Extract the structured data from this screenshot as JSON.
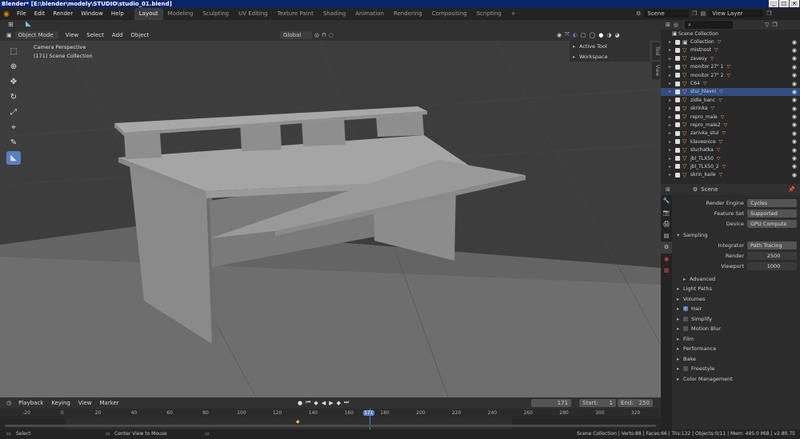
{
  "window": {
    "title": "Blender* [E:\\blender\\modely\\STUDIO\\studio_01.blend]"
  },
  "topbar": {
    "menus": [
      "File",
      "Edit",
      "Render",
      "Window",
      "Help"
    ],
    "workspaces": [
      "Layout",
      "Modeling",
      "Sculpting",
      "UV Editing",
      "Texture Paint",
      "Shading",
      "Animation",
      "Rendering",
      "Compositing",
      "Scripting"
    ],
    "active_workspace": "Layout",
    "add_tab": "+",
    "scene": "Scene",
    "view_layer": "View Layer"
  },
  "viewport_header": {
    "mode": "Object Mode",
    "menus": [
      "View",
      "Select",
      "Add",
      "Object"
    ],
    "orientation": "Global"
  },
  "viewport": {
    "camera_label": "Camera Perspective",
    "collection_label": "(171) Scene Collection",
    "n_panel": {
      "items": [
        "Active Tool",
        "Workspace"
      ],
      "tabs": [
        "Tool",
        "View"
      ]
    }
  },
  "timeline": {
    "menus": [
      "Playback",
      "Keying",
      "View",
      "Marker"
    ],
    "current_frame": "171",
    "start_label": "Start:",
    "start": "1",
    "end_label": "End:",
    "end": "250",
    "ruler": [
      "-20",
      "0",
      "20",
      "40",
      "60",
      "80",
      "100",
      "120",
      "140",
      "160",
      "171",
      "180",
      "200",
      "220",
      "240",
      "260",
      "280",
      "300",
      "320"
    ]
  },
  "outliner": {
    "root": "Scene Collection",
    "items": [
      {
        "name": "Collection",
        "selected": false
      },
      {
        "name": "mistnost",
        "selected": false
      },
      {
        "name": "zavesy",
        "selected": false
      },
      {
        "name": "monitor 27\" 1",
        "selected": false
      },
      {
        "name": "monitor 27\" 2",
        "selected": false
      },
      {
        "name": "C64",
        "selected": false
      },
      {
        "name": "stul_hlavni",
        "selected": true
      },
      {
        "name": "zidle_kanc",
        "selected": false
      },
      {
        "name": "skrinka",
        "selected": false
      },
      {
        "name": "repro_male",
        "selected": false
      },
      {
        "name": "repro_male2",
        "selected": false
      },
      {
        "name": "zarivka_stul",
        "selected": false
      },
      {
        "name": "klavesnice",
        "selected": false
      },
      {
        "name": "sluchatka",
        "selected": false
      },
      {
        "name": "jbl_TLX50",
        "selected": false
      },
      {
        "name": "jbl_TLX50_2",
        "selected": false
      },
      {
        "name": "skrin_kaile",
        "selected": false
      }
    ]
  },
  "properties": {
    "context": "Scene",
    "render_engine_label": "Render Engine",
    "render_engine": "Cycles",
    "feature_set_label": "Feature Set",
    "feature_set": "Supported",
    "device_label": "Device",
    "device": "GPU Compute",
    "sampling": "Sampling",
    "integrator_label": "Integrator",
    "integrator": "Path Tracing",
    "render_label": "Render",
    "render_samples": "2500",
    "viewport_label": "Viewport",
    "viewport_samples": "1000",
    "panels": [
      {
        "label": "Advanced",
        "check": null
      },
      {
        "label": "Light Paths",
        "check": null
      },
      {
        "label": "Volumes",
        "check": null
      },
      {
        "label": "Hair",
        "check": true
      },
      {
        "label": "Simplify",
        "check": false
      },
      {
        "label": "Motion Blur",
        "check": false
      },
      {
        "label": "Film",
        "check": null
      },
      {
        "label": "Performance",
        "check": null
      },
      {
        "label": "Bake",
        "check": null
      },
      {
        "label": "Freestyle",
        "check": false
      },
      {
        "label": "Color Management",
        "check": null
      }
    ]
  },
  "statusbar": {
    "select": "Select",
    "center": "Center View to Mouse",
    "stats": "Scene Collection | Verts:88 | Faces:66 | Tris:132 | Objects:0/11 | Mem: 495.0 MiB | v2.80.75"
  },
  "colors": {
    "accent": "#5680c2",
    "title_bg": "#0a246a",
    "object_icon": "#e8a45a"
  }
}
